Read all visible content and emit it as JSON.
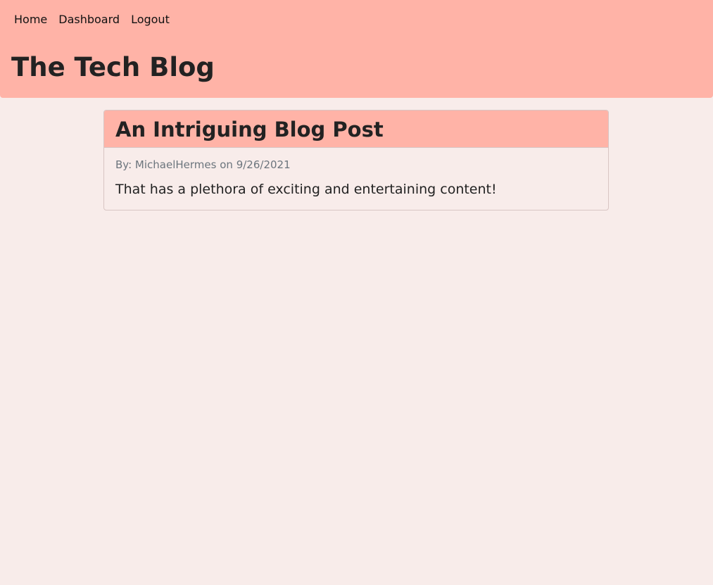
{
  "header": {
    "nav": {
      "home": "Home",
      "dashboard": "Dashboard",
      "logout": "Logout"
    },
    "title": "The Tech Blog"
  },
  "post": {
    "title": "An Intriguing Blog Post",
    "author_prefix": "By:",
    "author": "MichaelHermes",
    "date_prefix": "on",
    "date": "9/26/2021",
    "body": "That has a plethora of exciting and entertaining content!"
  },
  "colors": {
    "background": "#f8ecea",
    "header": "#ffb3a7",
    "text": "#222222",
    "meta": "#6c757d"
  }
}
